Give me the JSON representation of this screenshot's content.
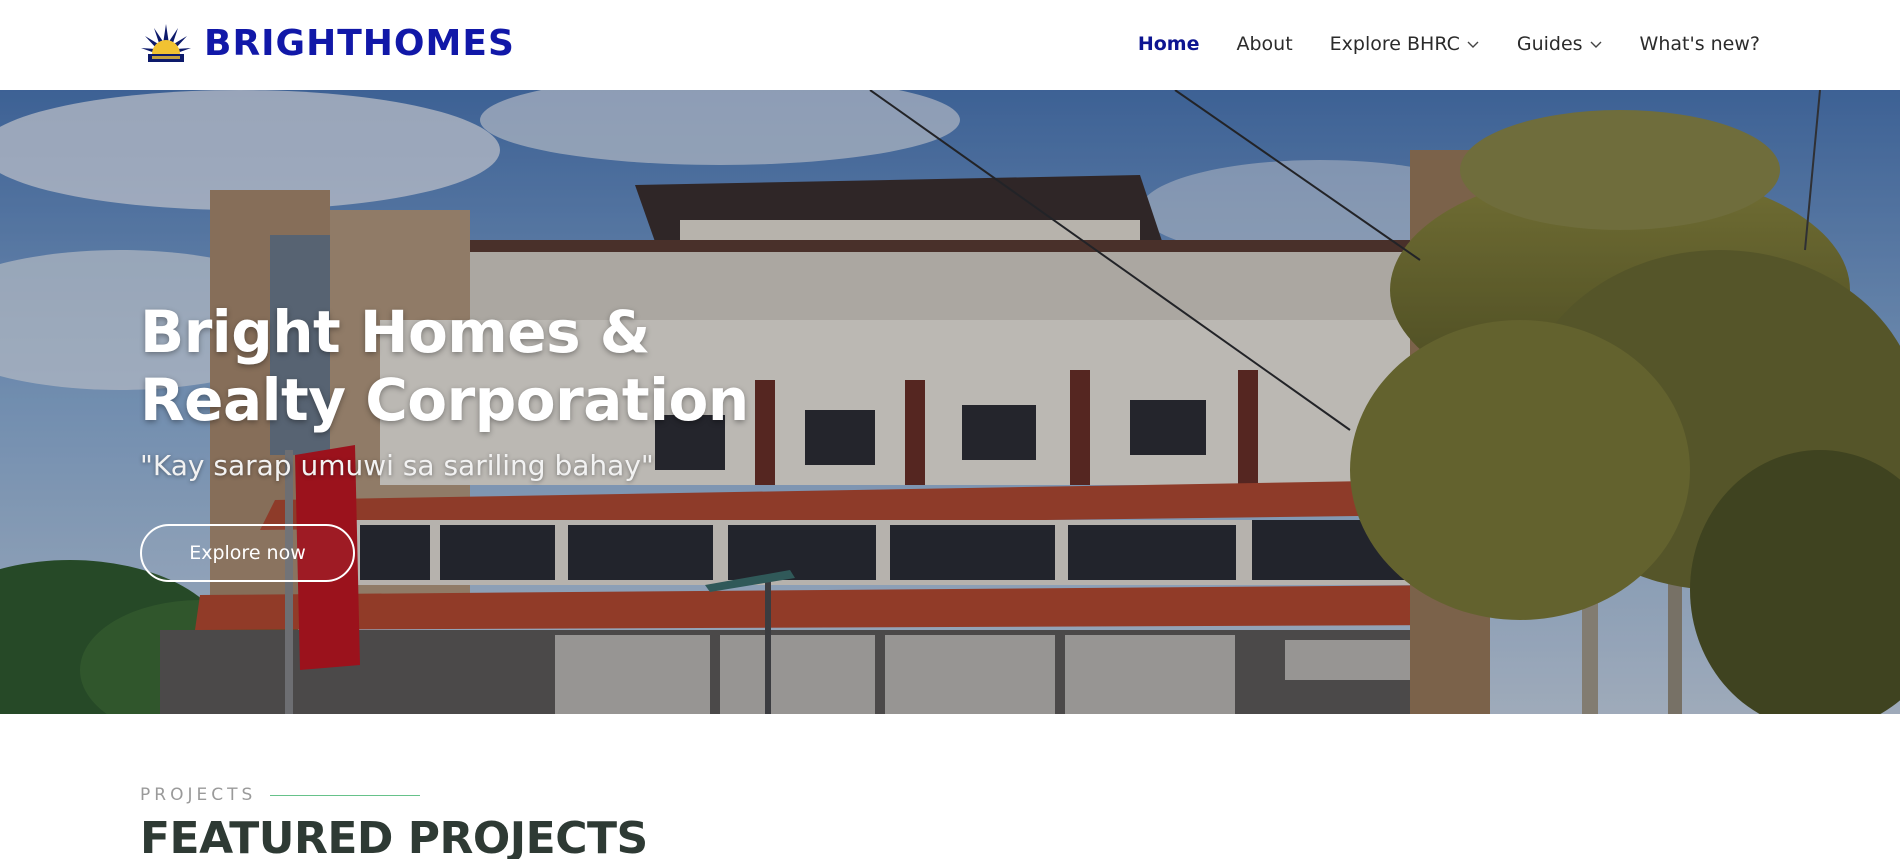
{
  "brand": {
    "name": "BRIGHTHOMES",
    "logo_icon": "sunburst-house-logo",
    "color": "#1118a8"
  },
  "nav": {
    "items": [
      {
        "label": "Home",
        "active": true,
        "dropdown": false
      },
      {
        "label": "About",
        "active": false,
        "dropdown": false
      },
      {
        "label": "Explore BHRC",
        "active": false,
        "dropdown": true
      },
      {
        "label": "Guides",
        "active": false,
        "dropdown": true
      },
      {
        "label": "What's new?",
        "active": false,
        "dropdown": false
      }
    ],
    "active_color": "#0d1591"
  },
  "hero": {
    "title_line1": "Bright Homes &",
    "title_line2": "Realty Corporation",
    "tagline": "\"Kay sarap umuwi sa sariling bahay\"",
    "button_label": "Explore now",
    "image": "building-with-palm-trees-photo"
  },
  "projects": {
    "eyebrow": "PROJECTS",
    "title": "FEATURED PROJECTS",
    "accent_color": "#66c28a"
  }
}
